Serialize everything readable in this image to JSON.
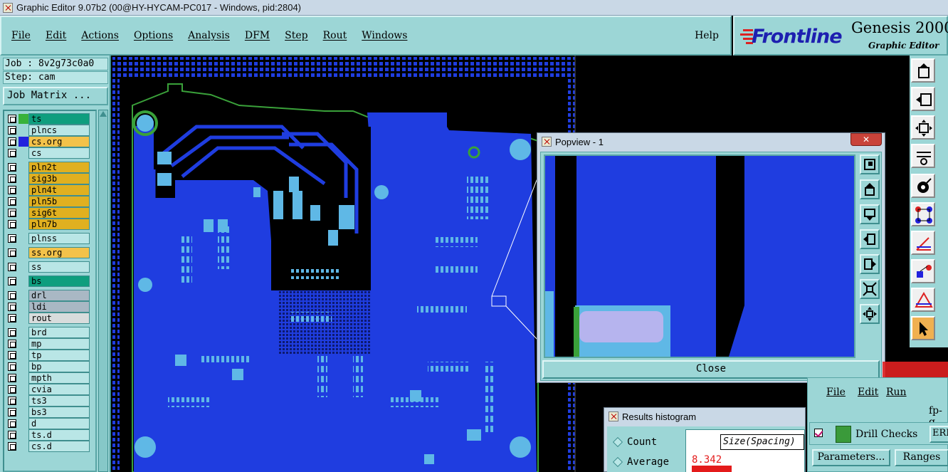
{
  "window": {
    "title": "Graphic Editor 9.07b2 (00@HY-HYCAM-PC017 - Windows, pid:2804)"
  },
  "menu": {
    "items": [
      "File",
      "Edit",
      "Actions",
      "Options",
      "Analysis",
      "DFM",
      "Step",
      "Rout",
      "Windows"
    ],
    "help": "Help"
  },
  "logo": {
    "brand": "Frontline",
    "product": "Genesis 2000",
    "subtitle": "Graphic Editor"
  },
  "job_panel": {
    "job": "Job : 8v2g73c0a0",
    "step": "Step: cam",
    "matrix_button": "Job Matrix ..."
  },
  "layers": [
    {
      "name": "ts",
      "color": "#0e9e7e",
      "swatch": "#38b23a"
    },
    {
      "name": "plncs",
      "color": "#b9e6e6",
      "swatch": ""
    },
    {
      "name": "cs.org",
      "color": "#f3c24a",
      "swatch": "#2222dd"
    },
    {
      "name": "cs",
      "color": "#b9e6e6",
      "swatch": ""
    },
    {
      "name": "pln2t",
      "color": "#e0b020",
      "swatch": ""
    },
    {
      "name": "sig3b",
      "color": "#e0b020",
      "swatch": ""
    },
    {
      "name": "pln4t",
      "color": "#e0b020",
      "swatch": ""
    },
    {
      "name": "pln5b",
      "color": "#e0b020",
      "swatch": ""
    },
    {
      "name": "sig6t",
      "color": "#e0b020",
      "swatch": ""
    },
    {
      "name": "pln7b",
      "color": "#e0b020",
      "swatch": ""
    },
    {
      "name": "plnss",
      "color": "#b9e6e6",
      "swatch": ""
    },
    {
      "name": "ss.org",
      "color": "#f3c24a",
      "swatch": ""
    },
    {
      "name": "ss",
      "color": "#b9e6e6",
      "swatch": ""
    },
    {
      "name": "bs",
      "color": "#0e9e7e",
      "swatch": ""
    },
    {
      "name": "drl",
      "color": "#a9b8c4",
      "swatch": ""
    },
    {
      "name": "ldi",
      "color": "#a9b8c4",
      "swatch": ""
    },
    {
      "name": "rout",
      "color": "#d8dcdc",
      "swatch": ""
    },
    {
      "name": "brd",
      "color": "#b9e6e6",
      "swatch": ""
    },
    {
      "name": "mp",
      "color": "#b9e6e6",
      "swatch": ""
    },
    {
      "name": "tp",
      "color": "#b9e6e6",
      "swatch": ""
    },
    {
      "name": "bp",
      "color": "#b9e6e6",
      "swatch": ""
    },
    {
      "name": "mpth",
      "color": "#b9e6e6",
      "swatch": ""
    },
    {
      "name": "cvia",
      "color": "#b9e6e6",
      "swatch": ""
    },
    {
      "name": "ts3",
      "color": "#b9e6e6",
      "swatch": ""
    },
    {
      "name": "bs3",
      "color": "#b9e6e6",
      "swatch": ""
    },
    {
      "name": "d",
      "color": "#b9e6e6",
      "swatch": ""
    },
    {
      "name": "ts.d",
      "color": "#b9e6e6",
      "swatch": ""
    },
    {
      "name": "cs.d",
      "color": "#b9e6e6",
      "swatch": ""
    }
  ],
  "popview": {
    "title": "Popview - 1",
    "close_label": "Close",
    "close_x": "✕"
  },
  "histogram": {
    "title": "Results histogram",
    "options": [
      "Count",
      "Average"
    ],
    "metric": "Size(Spacing)",
    "value": "8.342"
  },
  "drill_checks": {
    "menu": [
      "File",
      "Edit",
      "Run"
    ],
    "title": "fp-q",
    "check_label": "Drill Checks",
    "erf_label": "ERF",
    "parameters_button": "Parameters...",
    "ranges_button": "Ranges"
  },
  "colors": {
    "panel": "#9cd6d6",
    "board_copper": "#1f3de0",
    "pad": "#5fb8e6",
    "board_outline": "#3aa13a",
    "highlight": "#e41b1b"
  }
}
